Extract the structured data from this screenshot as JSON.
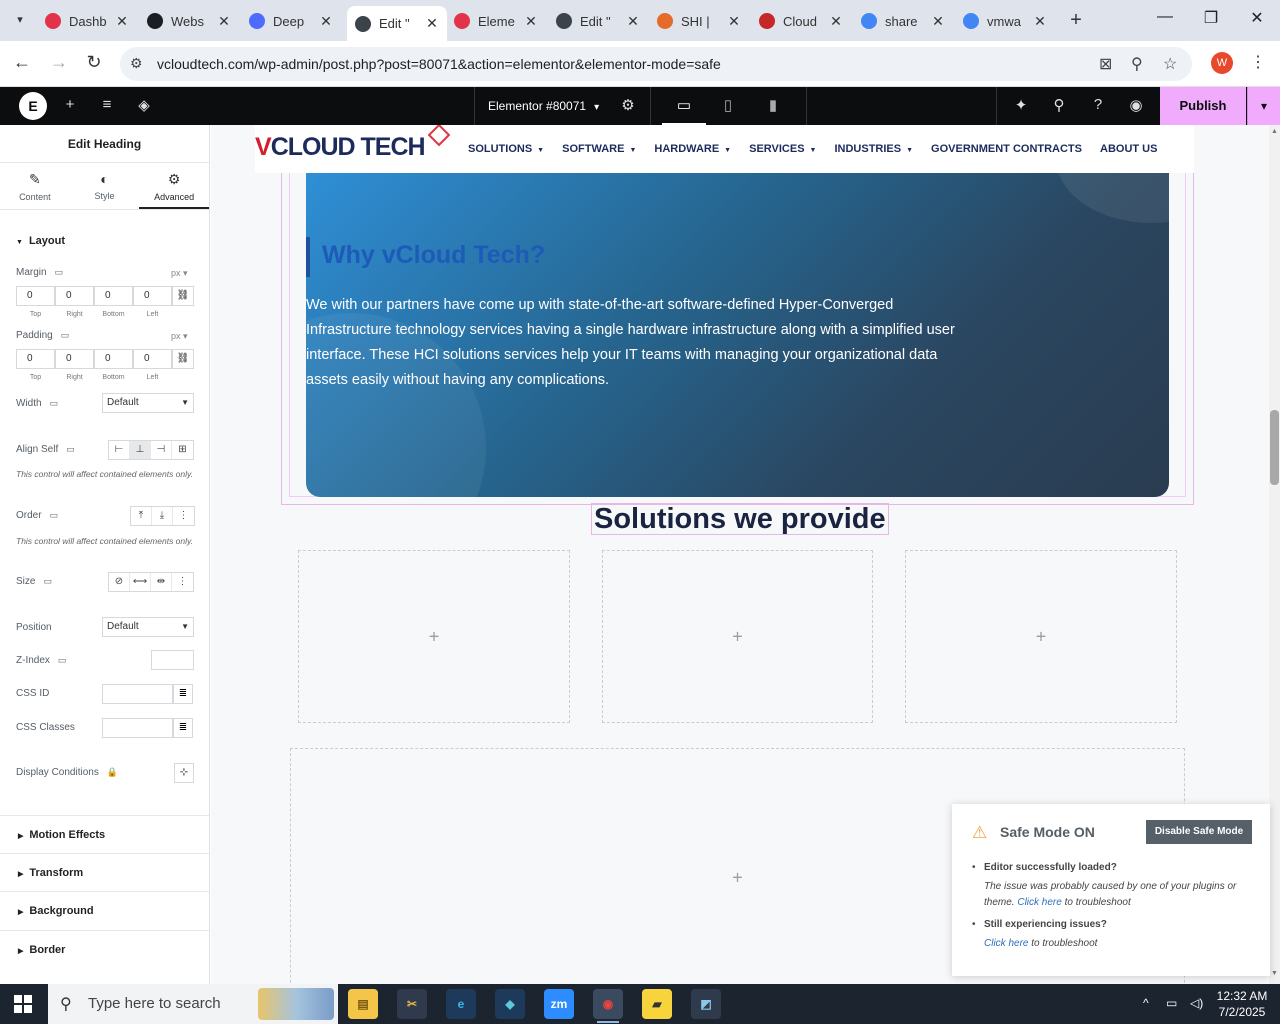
{
  "browser": {
    "tabs": [
      {
        "title": "Dashb",
        "icon": "elementor-red-icon",
        "color": "#e2334a"
      },
      {
        "title": "Webs",
        "icon": "github-icon",
        "color": "#1b1f23"
      },
      {
        "title": "Deep",
        "icon": "deepseek-icon",
        "color": "#4d6bfe"
      },
      {
        "title": "Edit \"",
        "icon": "wordpress-icon",
        "color": "#3c434a",
        "active": true
      },
      {
        "title": "Eleme",
        "icon": "elementor-red-icon",
        "color": "#e2334a"
      },
      {
        "title": "Edit \"",
        "icon": "wordpress-icon",
        "color": "#3c434a"
      },
      {
        "title": "SHI | ",
        "icon": "shi-icon",
        "color": "#e56b2d"
      },
      {
        "title": "Cloud",
        "icon": "cloud-icon",
        "color": "#c62828"
      },
      {
        "title": "share",
        "icon": "google-icon",
        "color": "#4285f4"
      },
      {
        "title": "vmwa",
        "icon": "google-icon",
        "color": "#4285f4"
      }
    ],
    "url": "vcloudtech.com/wp-admin/post.php?post=80071&action=elementor&elementor-mode=safe",
    "profile_initial": "W"
  },
  "editor": {
    "document_title": "Elementor #80071",
    "publish_label": "Publish"
  },
  "panel": {
    "title": "Edit Heading",
    "tabs": [
      {
        "label": "Content",
        "icon": "pencil-icon"
      },
      {
        "label": "Style",
        "icon": "half-circle-icon"
      },
      {
        "label": "Advanced",
        "icon": "gear-icon",
        "active": true
      }
    ],
    "layout_section": "Layout",
    "margin": {
      "label": "Margin",
      "unit": "px",
      "values": [
        "0",
        "0",
        "0",
        "0"
      ]
    },
    "padding": {
      "label": "Padding",
      "unit": "px",
      "values": [
        "0",
        "0",
        "0",
        "0"
      ]
    },
    "dim_labels": [
      "Top",
      "Right",
      "Bottom",
      "Left"
    ],
    "width": {
      "label": "Width",
      "value": "Default"
    },
    "align_self": {
      "label": "Align Self",
      "note": "This control will affect contained elements only."
    },
    "order": {
      "label": "Order",
      "note": "This control will affect contained elements only."
    },
    "size": {
      "label": "Size"
    },
    "position": {
      "label": "Position",
      "value": "Default"
    },
    "z_index": {
      "label": "Z-Index",
      "value": ""
    },
    "css_id": {
      "label": "CSS ID",
      "value": ""
    },
    "css_classes": {
      "label": "CSS Classes",
      "value": ""
    },
    "display_conditions": {
      "label": "Display Conditions"
    },
    "accordions": [
      "Motion Effects",
      "Transform",
      "Background",
      "Border"
    ]
  },
  "site": {
    "logo_v": "V",
    "logo_rest": "CLOUD TECH",
    "menu": [
      {
        "label": "SOLUTIONS",
        "dropdown": true
      },
      {
        "label": "SOFTWARE",
        "dropdown": true
      },
      {
        "label": "HARDWARE",
        "dropdown": true
      },
      {
        "label": "SERVICES",
        "dropdown": true
      },
      {
        "label": "INDUSTRIES",
        "dropdown": true
      },
      {
        "label": "GOVERNMENT CONTRACTS",
        "dropdown": false
      },
      {
        "label": "ABOUT US",
        "dropdown": false
      }
    ],
    "hero_title": "Why vCloud Tech?",
    "hero_text": "We with our partners have come up with state-of-the-art software-defined Hyper-Converged Infrastructure technology services having a single hardware infrastructure along with a simplified user interface. These HCI solutions services help your IT teams with managing your organizational data assets easily without having any complications.",
    "solutions_title": "Solutions we provide",
    "placeholder_plus": "+"
  },
  "safe_mode": {
    "title": "Safe Mode ON",
    "button": "Disable Safe Mode",
    "item1_head": "Editor successfully loaded?",
    "item1_text": "The issue was probably caused by one of your plugins or theme.",
    "item1_link": "Click here",
    "item1_tail": "to troubleshoot",
    "item2_head": "Still experiencing issues?",
    "item2_link": "Click here",
    "item2_tail": "to troubleshoot"
  },
  "taskbar": {
    "search_placeholder": "Type here to search",
    "time": "12:32 AM",
    "date": "7/2/2025"
  }
}
